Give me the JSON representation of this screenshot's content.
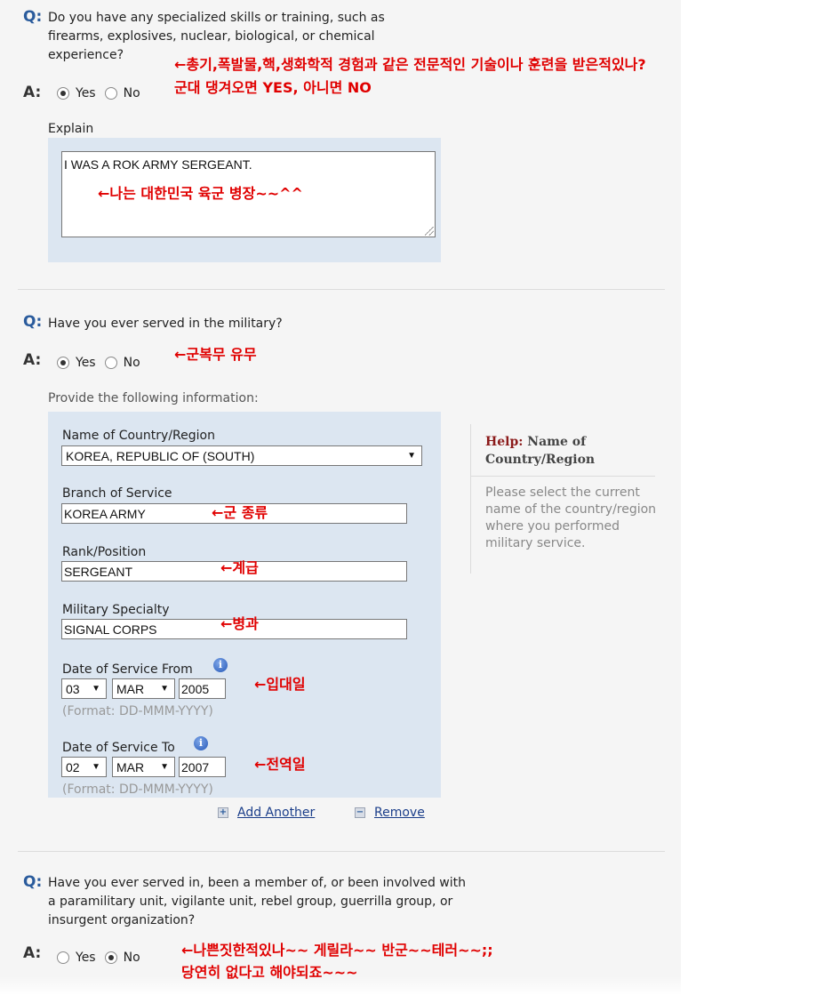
{
  "section1": {
    "q_marker": "Q:",
    "question": "Do you have any specialized skills or training, such as firearms, explosives, nuclear, biological, or chemical experience?",
    "a_marker": "A:",
    "yes_label": "Yes",
    "no_label": "No",
    "selected": "Yes",
    "explain_label": "Explain",
    "explain_value": "I WAS A ROK ARMY SERGEANT.",
    "annot_question": "←총기,폭발물,핵,생화학적 경험과 같은 전문적인 기술이나 훈련을 받은적있나?",
    "annot_answer": "군대 댕겨오면 YES, 아니면 NO",
    "annot_explain": "←나는 대한민국 육군 병장~~^^"
  },
  "section2": {
    "q_marker": "Q:",
    "question": "Have you ever served in the military?",
    "a_marker": "A:",
    "yes_label": "Yes",
    "no_label": "No",
    "selected": "Yes",
    "annot_answer": "←군복무 유무",
    "provide_label": "Provide the following information:",
    "country": {
      "label": "Name of Country/Region",
      "value": "KOREA, REPUBLIC OF (SOUTH)"
    },
    "branch": {
      "label": "Branch of Service",
      "value": "KOREA ARMY",
      "annot": "←군 종류"
    },
    "rank": {
      "label": "Rank/Position",
      "value": "SERGEANT",
      "annot": "←계급"
    },
    "specialty": {
      "label": "Military Specialty",
      "value": "SIGNAL CORPS",
      "annot": "←병과"
    },
    "date_from": {
      "label": "Date of Service From",
      "day": "03",
      "month": "MAR",
      "year": "2005",
      "format": "(Format: DD-MMM-YYYY)",
      "annot": "←입대일"
    },
    "date_to": {
      "label": "Date of Service To",
      "day": "02",
      "month": "MAR",
      "year": "2007",
      "format": "(Format: DD-MMM-YYYY)",
      "annot": "←전역일"
    },
    "add_another": "Add Another",
    "remove": "Remove",
    "help": {
      "prefix": "Help:",
      "title": "Name of Country/Region",
      "body": "Please select the current name of the country/region where you performed military service."
    }
  },
  "section3": {
    "q_marker": "Q:",
    "question": "Have you ever served in, been a member of, or been involved with a paramilitary unit, vigilante unit, rebel group, guerrilla group, or insurgent organization?",
    "a_marker": "A:",
    "yes_label": "Yes",
    "no_label": "No",
    "selected": "No",
    "annot_line1": "←나쁜짓한적있나~~ 게릴라~~ 반군~~테러~~;;",
    "annot_line2": "당연히 없다고 해야되죠~~~"
  },
  "icons": {
    "info": "info-icon",
    "dropdown": "dropdown-arrow-icon",
    "add": "add-icon",
    "remove": "remove-icon",
    "radio": "radio-icon"
  }
}
